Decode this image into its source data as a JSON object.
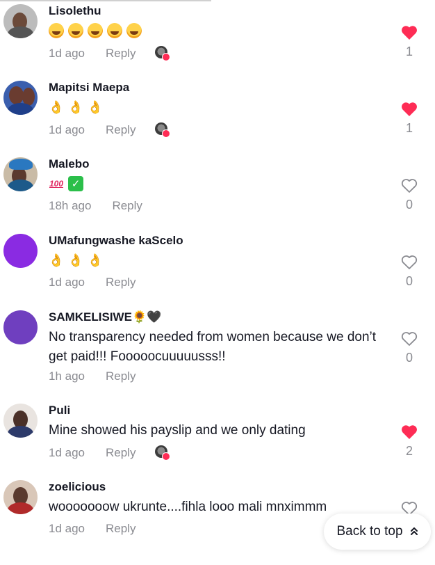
{
  "comments": [
    {
      "username": "Lisolethu",
      "emojis": [
        "laugh",
        "laugh",
        "laugh",
        "laugh",
        "laugh"
      ],
      "time": "1d ago",
      "reply": "Reply",
      "liked": true,
      "count": "1",
      "creator_liked": true
    },
    {
      "username": "Mapitsi Maepa",
      "emojis": [
        "ok",
        "ok",
        "ok"
      ],
      "time": "1d ago",
      "reply": "Reply",
      "liked": true,
      "count": "1",
      "creator_liked": true
    },
    {
      "username": "Malebo",
      "emojis": [
        "100",
        "check"
      ],
      "time": "18h ago",
      "reply": "Reply",
      "liked": false,
      "count": "0",
      "creator_liked": false
    },
    {
      "username": "UMafungwashe kaScelo",
      "emojis": [
        "ok",
        "ok",
        "ok"
      ],
      "time": "1d ago",
      "reply": "Reply",
      "liked": false,
      "count": "0",
      "creator_liked": false
    },
    {
      "username": "SAMKELISIWE🌻🖤",
      "text": "No transparency needed from women because we don’t get paid!!! Fooooocuuuuusss!!",
      "time": "1h ago",
      "reply": "Reply",
      "liked": false,
      "count": "0",
      "creator_liked": false
    },
    {
      "username": "Puli",
      "text": "Mine showed his payslip and we only dating",
      "time": "1d ago",
      "reply": "Reply",
      "liked": true,
      "count": "2",
      "creator_liked": true
    },
    {
      "username": "zoelicious",
      "text": "wooooooow ukrunte....fihla looo mali mnximmm",
      "time": "1d ago",
      "reply": "Reply",
      "liked": false,
      "count": "",
      "creator_liked": false
    }
  ],
  "back_to_top": {
    "label": "Back to top",
    "icon": "double-chevron-up-icon"
  },
  "colors": {
    "like_red": "#fe2c55",
    "meta_gray": "#8a8b91",
    "purple_avatar": "#8a2be2",
    "purple_avatar_2": "#6f3fbf"
  }
}
